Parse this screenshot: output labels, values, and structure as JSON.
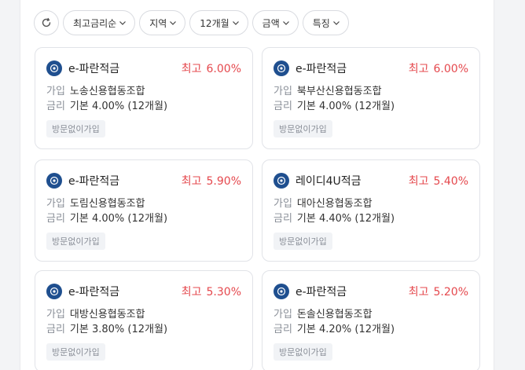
{
  "filters": {
    "sort_label": "최고금리순",
    "region_label": "지역",
    "period_label": "12개월",
    "amount_label": "금액",
    "feature_label": "특징"
  },
  "products": [
    {
      "name": "e-파란적금",
      "rate_label": "최고",
      "rate": "6.00%",
      "join_key": "가입",
      "join_value": "노송신용협동조합",
      "rate_key": "금리",
      "base_rate": "기본 4.00% (12개월)",
      "tag": "방문없이가입"
    },
    {
      "name": "e-파란적금",
      "rate_label": "최고",
      "rate": "6.00%",
      "join_key": "가입",
      "join_value": "북부산신용협동조합",
      "rate_key": "금리",
      "base_rate": "기본 4.00% (12개월)",
      "tag": "방문없이가입"
    },
    {
      "name": "e-파란적금",
      "rate_label": "최고",
      "rate": "5.90%",
      "join_key": "가입",
      "join_value": "도림신용협동조합",
      "rate_key": "금리",
      "base_rate": "기본 4.00% (12개월)",
      "tag": "방문없이가입"
    },
    {
      "name": "레이디4U적금",
      "rate_label": "최고",
      "rate": "5.40%",
      "join_key": "가입",
      "join_value": "대아신용협동조합",
      "rate_key": "금리",
      "base_rate": "기본 4.40% (12개월)",
      "tag": "방문없이가입"
    },
    {
      "name": "e-파란적금",
      "rate_label": "최고",
      "rate": "5.30%",
      "join_key": "가입",
      "join_value": "대방신용협동조합",
      "rate_key": "금리",
      "base_rate": "기본 3.80% (12개월)",
      "tag": "방문없이가입"
    },
    {
      "name": "e-파란적금",
      "rate_label": "최고",
      "rate": "5.20%",
      "join_key": "가입",
      "join_value": "돈솔신용협동조합",
      "rate_key": "금리",
      "base_rate": "기본 4.20% (12개월)",
      "tag": "방문없이가입"
    }
  ],
  "colors": {
    "accent_rate": "#e5484d",
    "logo_blue": "#1f4f8f"
  }
}
